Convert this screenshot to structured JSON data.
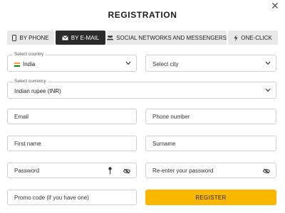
{
  "title": "REGISTRATION",
  "tabs": [
    {
      "label": "BY PHONE",
      "icon": "phone-icon",
      "active": false
    },
    {
      "label": "BY E-MAIL",
      "icon": "envelope-icon",
      "active": true
    },
    {
      "label": "SOCIAL NETWORKS AND MESSENGERS",
      "icon": "people-icon",
      "active": false
    },
    {
      "label": "ONE-CLICK",
      "icon": "lightning-icon",
      "active": false
    }
  ],
  "country": {
    "label": "Select country",
    "value": "India"
  },
  "city": {
    "placeholder": "Select city"
  },
  "currency": {
    "label": "Select currency",
    "value": "Indian rupee (INR)"
  },
  "email": {
    "placeholder": "Email"
  },
  "phone": {
    "placeholder": "Phone number"
  },
  "first_name": {
    "placeholder": "First name"
  },
  "surname": {
    "placeholder": "Surname"
  },
  "password": {
    "placeholder": "Password"
  },
  "repassword": {
    "placeholder": "Re-enter your password"
  },
  "promo": {
    "placeholder": "Promo code (if you have one)"
  },
  "register_label": "REGISTER",
  "colors": {
    "accent": "#f9b700",
    "active_tab": "#2b2b2b",
    "tab_bg": "#e9e9e9",
    "border": "#cfcfcf"
  }
}
